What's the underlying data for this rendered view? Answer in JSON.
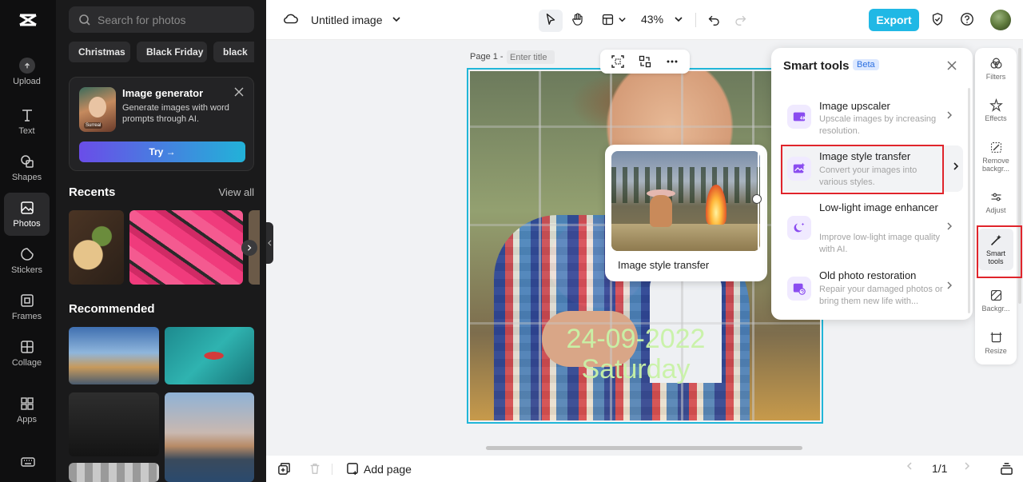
{
  "app": {
    "title": "Untitled image",
    "zoom": "43%",
    "export_label": "Export"
  },
  "left_rail": {
    "items": [
      {
        "label": "Upload",
        "icon": "upload-icon"
      },
      {
        "label": "Text",
        "icon": "text-icon"
      },
      {
        "label": "Shapes",
        "icon": "shapes-icon"
      },
      {
        "label": "Photos",
        "icon": "photos-icon",
        "active": true
      },
      {
        "label": "Stickers",
        "icon": "stickers-icon"
      },
      {
        "label": "Frames",
        "icon": "frames-icon"
      },
      {
        "label": "Collage",
        "icon": "collage-icon"
      },
      {
        "label": "Apps",
        "icon": "apps-icon"
      }
    ]
  },
  "photos_panel": {
    "search_placeholder": "Search for photos",
    "chips": [
      "Christmas",
      "Black Friday",
      "black"
    ],
    "generator": {
      "title": "Image generator",
      "description": "Generate images with word prompts through AI.",
      "thumb_tag": "Surreal",
      "try_label": "Try →"
    },
    "recents_title": "Recents",
    "view_all_label": "View all",
    "recommended_title": "Recommended"
  },
  "canvas": {
    "page_label": "Page 1 -",
    "title_placeholder": "Enter title",
    "overlay_lines": [
      "24-09-2022",
      "Saturday"
    ]
  },
  "preview": {
    "label": "Image style transfer"
  },
  "smart_tools": {
    "title": "Smart tools",
    "badge": "Beta",
    "items": [
      {
        "name": "Image upscaler",
        "desc": "Upscale images by increasing resolution."
      },
      {
        "name": "Image style transfer",
        "desc": "Convert your images into various styles."
      },
      {
        "name": "Low-light image enhancer",
        "desc": "Improve low-light image quality with AI."
      },
      {
        "name": "Old photo restoration",
        "desc": "Repair your damaged photos or bring them new life with..."
      }
    ]
  },
  "right_rail": {
    "items": [
      {
        "label": "Filters"
      },
      {
        "label": "Effects"
      },
      {
        "label": "Remove backgr..."
      },
      {
        "label": "Adjust"
      },
      {
        "label": "Smart tools",
        "active": true
      },
      {
        "label": "Backgr..."
      },
      {
        "label": "Resize"
      }
    ]
  },
  "bottom_bar": {
    "add_page_label": "Add page",
    "page_count": "1/1"
  },
  "colors": {
    "accent": "#20b8e5",
    "highlight": "#e0242b",
    "selection": "#21b6d8"
  }
}
